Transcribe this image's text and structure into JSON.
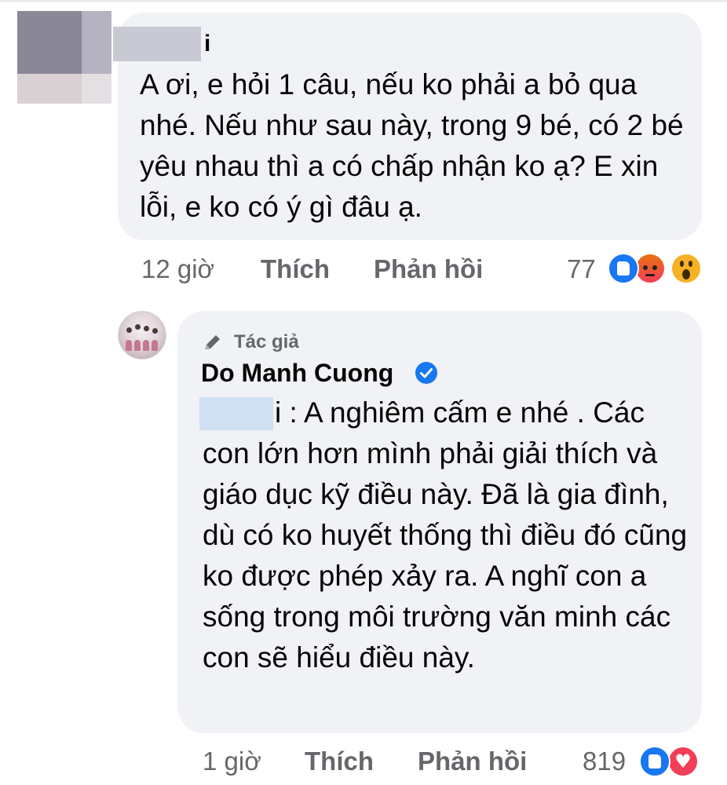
{
  "comment1": {
    "author_suffix": "i",
    "text": "A ơi, e hỏi 1 câu, nếu ko phải a bỏ qua nhé. Nếu như sau này, trong 9 bé, có 2 bé yêu nhau thì a có chấp nhận ko ạ? E xin lỗi, e ko có ý gì đâu ạ.",
    "time": "12 giờ",
    "like_label": "Thích",
    "reply_label": "Phản hồi",
    "reaction_count": "77",
    "reactions": [
      "like-icon",
      "angry-icon",
      "wow-icon"
    ]
  },
  "reply": {
    "badge_label": "Tác giả",
    "author": "Do Manh Cuong",
    "mention_suffix": "i",
    "text": " : A nghiêm cấm e nhé . Các con lớn hơn mình phải giải thích và giáo dục kỹ điều này. Đã là gia đình, dù có ko huyết thống thì điều đó cũng ko được phép xảy ra. A nghĩ con a sống trong môi trường văn minh các con sẽ hiểu điều này.",
    "time": "1 giờ",
    "like_label": "Thích",
    "reply_label": "Phản hồi",
    "reaction_count": "819",
    "reactions": [
      "like-icon",
      "love-icon"
    ]
  },
  "colors": {
    "bubble": "#f0f2f5",
    "meta_text": "#65676b",
    "like_blue": "#1877f2",
    "love_red": "#f33e58",
    "verified_blue": "#1877f2"
  }
}
